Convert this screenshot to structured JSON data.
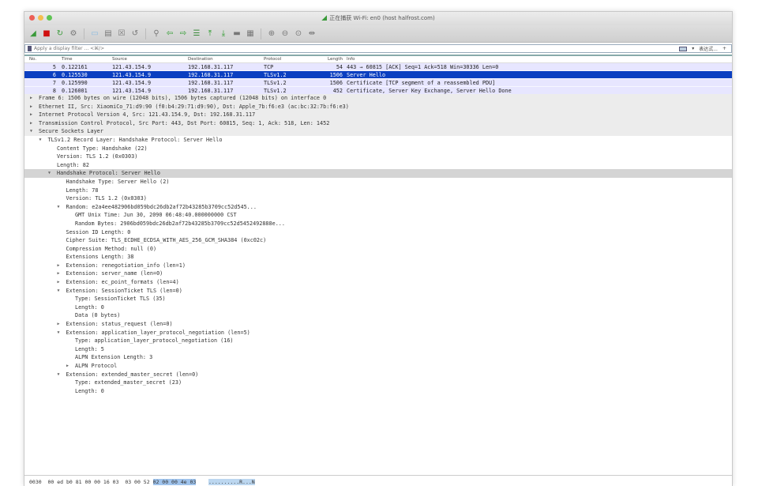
{
  "window": {
    "title": "正在捕获 Wi-Fi: en0 (host halfrost.com)"
  },
  "colors": {
    "selected_row": "#0b3fc1",
    "tls_row": "#e7e6ff",
    "close": "#ec5f57",
    "minimize": "#f4be4f",
    "zoom": "#5fc454"
  },
  "toolbar": {
    "icons": [
      "shark-fin-start-icon",
      "stop-icon",
      "restart-icon",
      "options-gear-icon",
      "open-file-icon",
      "save-file-icon",
      "close-file-icon",
      "reload-icon",
      "find-icon",
      "go-back-icon",
      "go-forward-icon",
      "go-to-packet-icon",
      "go-first-icon",
      "go-last-icon",
      "autoscroll-icon",
      "colorize-icon",
      "zoom-in-icon",
      "zoom-out-icon",
      "normal-size-icon",
      "resize-columns-icon"
    ]
  },
  "filter": {
    "placeholder": "Apply a display filter ... <⌘/>",
    "expression_label": "表达式...",
    "add_label": "+"
  },
  "packet_list": {
    "columns": [
      "No.",
      "Time",
      "Source",
      "Destination",
      "Protocol",
      "Length",
      "Info"
    ],
    "rows": [
      {
        "no": "5",
        "time": "0.122161",
        "source": "121.43.154.9",
        "destination": "192.168.31.117",
        "protocol": "TCP",
        "length": "54",
        "info": "443 → 60815 [ACK] Seq=1 Ack=518 Win=30336 Len=0"
      },
      {
        "no": "6",
        "time": "0.125530",
        "source": "121.43.154.9",
        "destination": "192.168.31.117",
        "protocol": "TLSv1.2",
        "length": "1506",
        "info": "Server Hello",
        "selected": true
      },
      {
        "no": "7",
        "time": "0.125990",
        "source": "121.43.154.9",
        "destination": "192.168.31.117",
        "protocol": "TLSv1.2",
        "length": "1506",
        "info": "Certificate [TCP segment of a reassembled PDU]"
      },
      {
        "no": "8",
        "time": "0.126001",
        "source": "121.43.154.9",
        "destination": "192.168.31.117",
        "protocol": "TLSv1.2",
        "length": "452",
        "info": "Certificate, Server Key Exchange, Server Hello Done"
      }
    ]
  },
  "details": [
    {
      "level": 0,
      "state": "collapsed",
      "text": "Frame 6: 1506 bytes on wire (12048 bits), 1506 bytes captured (12048 bits) on interface 0"
    },
    {
      "level": 0,
      "state": "collapsed",
      "text": "Ethernet II, Src: XiaomiCo_71:d9:90 (f0:b4:29:71:d9:90), Dst: Apple_7b:f6:e3 (ac:bc:32:7b:f6:e3)"
    },
    {
      "level": 0,
      "state": "collapsed",
      "text": "Internet Protocol Version 4, Src: 121.43.154.9, Dst: 192.168.31.117"
    },
    {
      "level": 0,
      "state": "collapsed",
      "text": "Transmission Control Protocol, Src Port: 443, Dst Port: 60815, Seq: 1, Ack: 518, Len: 1452"
    },
    {
      "level": 0,
      "state": "expanded",
      "text": "Secure Sockets Layer"
    },
    {
      "level": 1,
      "state": "expanded",
      "text": "TLSv1.2 Record Layer: Handshake Protocol: Server Hello"
    },
    {
      "level": 2,
      "state": "leaf",
      "text": "Content Type: Handshake (22)"
    },
    {
      "level": 2,
      "state": "leaf",
      "text": "Version: TLS 1.2 (0x0303)"
    },
    {
      "level": 2,
      "state": "leaf",
      "text": "Length: 82"
    },
    {
      "level": 2,
      "state": "expanded",
      "text": "Handshake Protocol: Server Hello",
      "highlighted": true
    },
    {
      "level": 3,
      "state": "leaf",
      "text": "Handshake Type: Server Hello (2)"
    },
    {
      "level": 3,
      "state": "leaf",
      "text": "Length: 78"
    },
    {
      "level": 3,
      "state": "leaf",
      "text": "Version: TLS 1.2 (0x0303)"
    },
    {
      "level": 3,
      "state": "expanded",
      "text": "Random: e2a4ee482906bd059bdc26db2af72b43285b3709cc52d545..."
    },
    {
      "level": 4,
      "state": "leaf",
      "text": "GMT Unix Time: Jun 30, 2090 06:48:40.000000000 CST"
    },
    {
      "level": 4,
      "state": "leaf",
      "text": "Random Bytes: 2906bd059bdc26db2af72b43285b3709cc52d5452492888e..."
    },
    {
      "level": 3,
      "state": "leaf",
      "text": "Session ID Length: 0"
    },
    {
      "level": 3,
      "state": "leaf",
      "text": "Cipher Suite: TLS_ECDHE_ECDSA_WITH_AES_256_GCM_SHA384 (0xc02c)"
    },
    {
      "level": 3,
      "state": "leaf",
      "text": "Compression Method: null (0)"
    },
    {
      "level": 3,
      "state": "leaf",
      "text": "Extensions Length: 38"
    },
    {
      "level": 3,
      "state": "collapsed",
      "text": "Extension: renegotiation_info (len=1)"
    },
    {
      "level": 3,
      "state": "collapsed",
      "text": "Extension: server_name (len=0)"
    },
    {
      "level": 3,
      "state": "collapsed",
      "text": "Extension: ec_point_formats (len=4)"
    },
    {
      "level": 3,
      "state": "expanded",
      "text": "Extension: SessionTicket TLS (len=0)"
    },
    {
      "level": 4,
      "state": "leaf",
      "text": "Type: SessionTicket TLS (35)"
    },
    {
      "level": 4,
      "state": "leaf",
      "text": "Length: 0"
    },
    {
      "level": 4,
      "state": "leaf",
      "text": "Data (0 bytes)"
    },
    {
      "level": 3,
      "state": "collapsed",
      "text": "Extension: status_request (len=0)"
    },
    {
      "level": 3,
      "state": "expanded",
      "text": "Extension: application_layer_protocol_negotiation (len=5)"
    },
    {
      "level": 4,
      "state": "leaf",
      "text": "Type: application_layer_protocol_negotiation (16)"
    },
    {
      "level": 4,
      "state": "leaf",
      "text": "Length: 5"
    },
    {
      "level": 4,
      "state": "leaf",
      "text": "ALPN Extension Length: 3"
    },
    {
      "level": 4,
      "state": "collapsed",
      "text": "ALPN Protocol"
    },
    {
      "level": 3,
      "state": "expanded",
      "text": "Extension: extended_master_secret (len=0)"
    },
    {
      "level": 4,
      "state": "leaf",
      "text": "Type: extended_master_secret (23)"
    },
    {
      "level": 4,
      "state": "leaf",
      "text": "Length: 0"
    }
  ],
  "hex": {
    "offset": "0030",
    "bytes_a": "00 ed b0 81 00 00 16 03  03 00 52 ",
    "bytes_b": "02 00 00 4e 03",
    "ascii": "..........R...N"
  }
}
